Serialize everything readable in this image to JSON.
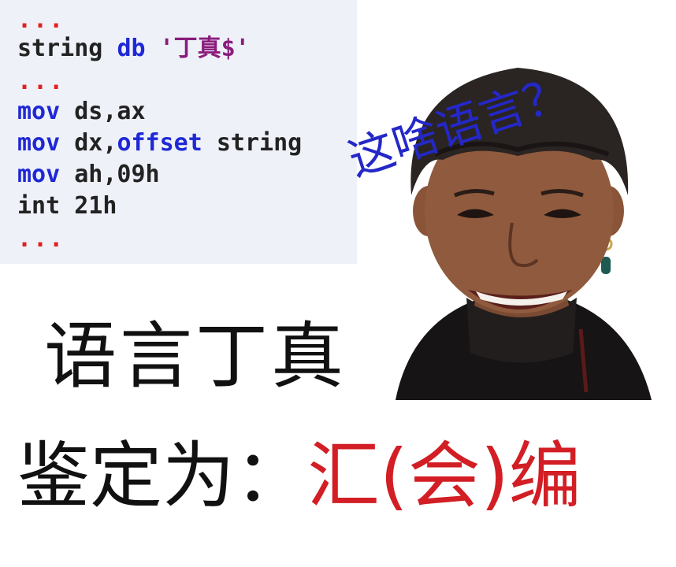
{
  "code": {
    "line1": "...",
    "line2_var": "string",
    "line2_kw": "db",
    "line2_str": "'丁真$'",
    "line3": "...",
    "line4_kw": "mov",
    "line4_rest": "ds,ax",
    "line5_kw": "mov",
    "line5_reg": "dx,",
    "line5_kw2": "offset",
    "line5_rest": "string",
    "line6_kw": "mov",
    "line6_rest": "ah,09h",
    "line7": "int 21h",
    "line8": "..."
  },
  "bubble": "这啥语言？",
  "title": "语言丁真",
  "verdict": {
    "label": "鉴定为：",
    "value": "汇(会)编"
  },
  "colors": {
    "keyword": "#1f28d6",
    "string": "#8a1c7c",
    "dots": "#e02020",
    "bubble": "#2428c8",
    "verdict_value": "#d21e24",
    "code_bg": "#eef1f8"
  }
}
